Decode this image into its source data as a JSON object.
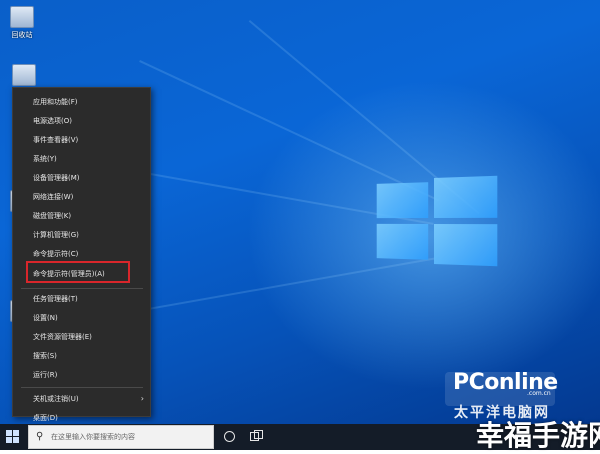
{
  "desktop": {
    "icons": [
      {
        "name": "recycle-bin-icon",
        "label": "回收站"
      }
    ]
  },
  "context_menu": {
    "items": [
      {
        "label": "应用和功能(F)"
      },
      {
        "label": "电源选项(O)"
      },
      {
        "label": "事件查看器(V)"
      },
      {
        "label": "系统(Y)"
      },
      {
        "label": "设备管理器(M)"
      },
      {
        "label": "网络连接(W)"
      },
      {
        "label": "磁盘管理(K)"
      },
      {
        "label": "计算机管理(G)"
      },
      {
        "label": "命令提示符(C)"
      },
      {
        "label": "命令提示符(管理员)(A)",
        "highlighted": true
      },
      {
        "label": "任务管理器(T)"
      },
      {
        "label": "设置(N)"
      },
      {
        "label": "文件资源管理器(E)"
      },
      {
        "label": "搜索(S)"
      },
      {
        "label": "运行(R)"
      },
      {
        "label": "关机或注销(U)",
        "has_submenu": true
      },
      {
        "label": "桌面(D)"
      }
    ],
    "highlight_color": "#d9262b",
    "background": "#2b2b2b"
  },
  "taskbar": {
    "search_placeholder": "在这里输入你要搜索的内容",
    "icons": [
      "windows-start-icon",
      "search-icon",
      "cortana-circle-icon",
      "task-view-icon"
    ]
  },
  "watermarks": {
    "pconline": "PConline",
    "pconline_domain": ".com.cn",
    "pconline_cn": "太平洋电脑网",
    "site": "幸福手游网"
  }
}
